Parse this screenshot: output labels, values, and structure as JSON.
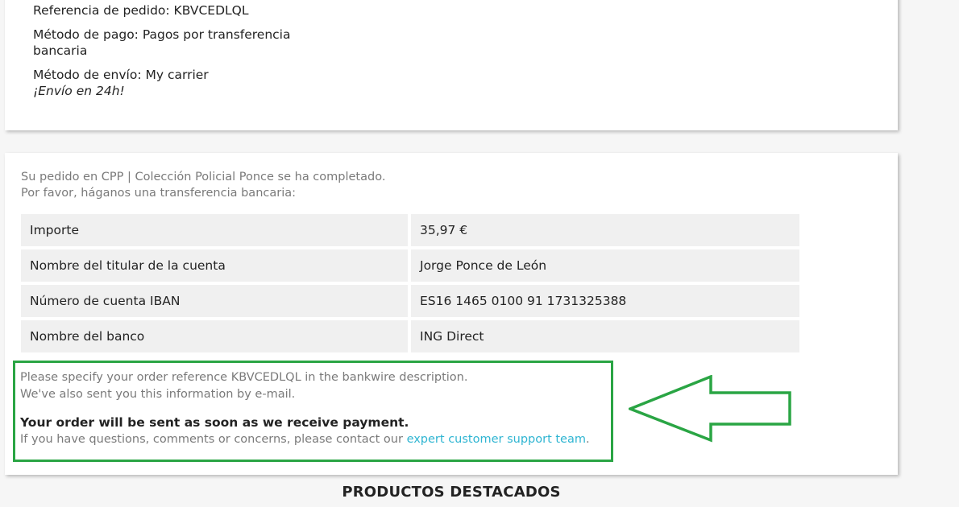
{
  "order_details": {
    "reference": "Referencia de pedido: KBVCEDLQL",
    "payment_line1": "Método de pago: Pagos por transferencia",
    "payment_line2": "bancaria",
    "shipping": "Método de envío: My carrier",
    "shipping_note": "¡Envío en 24h!"
  },
  "confirmation": {
    "line1": "Su pedido en CPP | Colección Policial Ponce se ha completado.",
    "line2": "Por favor, háganos una transferencia bancaria:"
  },
  "bank_table": [
    {
      "label": "Importe",
      "value": "35,97 €"
    },
    {
      "label": "Nombre del titular de la cuenta",
      "value": "Jorge Ponce de León"
    },
    {
      "label": "Número de cuenta IBAN",
      "value": "ES16 1465 0100 91 1731325388"
    },
    {
      "label": "Nombre del banco",
      "value": "ING Direct"
    }
  ],
  "note": {
    "line1": "Please specify your order reference KBVCEDLQL in the bankwire description.",
    "line2": "We've also sent you this information by e-mail.",
    "strong": "Your order will be sent as soon as we receive payment.",
    "contact_prefix": "If you have questions, comments or concerns, please contact our",
    "contact_link": "expert customer support team",
    "contact_suffix": "."
  },
  "featured_title": "PRODUCTOS DESTACADOS",
  "colors": {
    "highlight_box": "#2aa544",
    "link": "#2fb5d2",
    "row_background": "#f0f0f0"
  }
}
